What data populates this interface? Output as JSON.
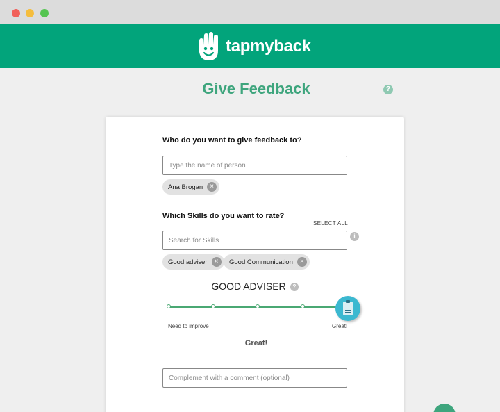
{
  "app": {
    "brand": "tapmyback"
  },
  "page": {
    "title": "Give Feedback",
    "help_icon_text": "?"
  },
  "form": {
    "recipient": {
      "label": "Who do you want to give feedback to?",
      "placeholder": "Type the name of person",
      "selected": [
        {
          "label": "Ana Brogan"
        }
      ]
    },
    "skills": {
      "label": "Which Skills do you want to rate?",
      "select_all": "SELECT ALL",
      "placeholder": "Search for Skills",
      "info_icon_text": "i",
      "selected": [
        {
          "label": "Good adviser"
        },
        {
          "label": "Good Communication"
        }
      ]
    },
    "rating": {
      "skill_name": "GOOD ADVISER",
      "help_icon_text": "?",
      "scale_min_label": "Need to improve",
      "scale_max_label": "Great!",
      "value": 5,
      "max": 5,
      "result_label": "Great!"
    },
    "comment": {
      "placeholder": "Complement with a comment (optional)"
    }
  },
  "chip_remove_icon": "×",
  "colors": {
    "brand_green": "#02a47b",
    "title_green": "#3ea57d",
    "slider_green": "#4aa873",
    "knob_blue": "#3bb8d0"
  }
}
